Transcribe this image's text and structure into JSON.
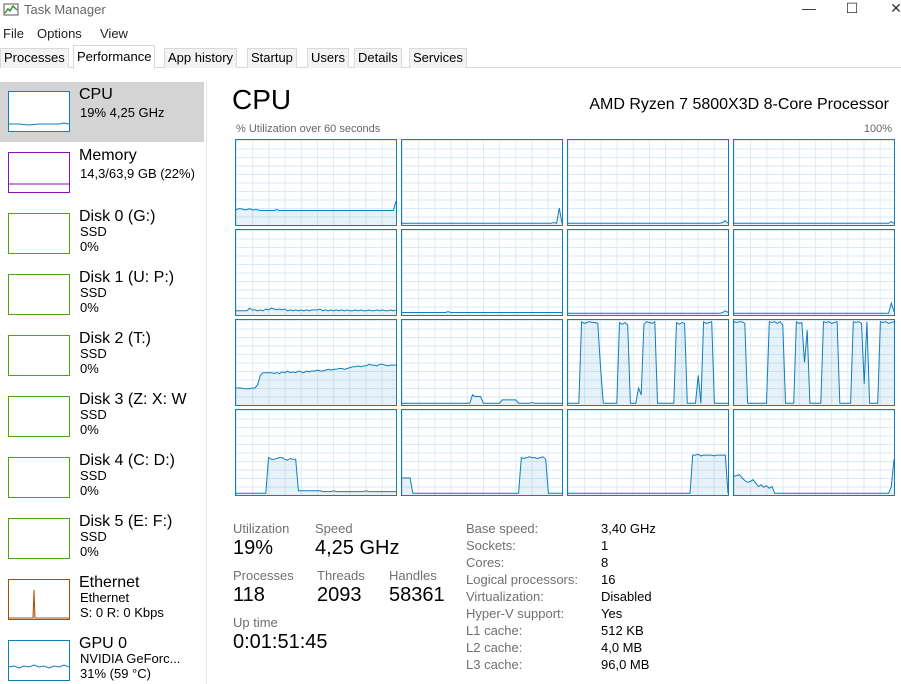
{
  "window": {
    "title": "Task Manager",
    "minimize": "—",
    "maximize": "☐",
    "close": "✕"
  },
  "menu": [
    "File",
    "Options",
    "View"
  ],
  "tabs": [
    "Processes",
    "Performance",
    "App history",
    "Startup",
    "Users",
    "Details",
    "Services"
  ],
  "active_tab": "Performance",
  "sidebar": [
    {
      "name": "CPU",
      "sub1": "19% 4,25 GHz",
      "sub2": "",
      "color": "#117dbb"
    },
    {
      "name": "Memory",
      "sub1": "14,3/63,9 GB (22%)",
      "sub2": "",
      "color": "#8b12ae"
    },
    {
      "name": "Disk 0 (G:)",
      "sub1": "SSD",
      "sub2": "0%",
      "color": "#4da60c"
    },
    {
      "name": "Disk 1 (U: P:)",
      "sub1": "SSD",
      "sub2": "0%",
      "color": "#4da60c"
    },
    {
      "name": "Disk 2 (T:)",
      "sub1": "SSD",
      "sub2": "0%",
      "color": "#4da60c"
    },
    {
      "name": "Disk 3 (Z: X: W",
      "sub1": "SSD",
      "sub2": "0%",
      "color": "#4da60c"
    },
    {
      "name": "Disk 4 (C: D:)",
      "sub1": "SSD",
      "sub2": "0%",
      "color": "#4da60c"
    },
    {
      "name": "Disk 5 (E: F:)",
      "sub1": "SSD",
      "sub2": "0%",
      "color": "#4da60c"
    },
    {
      "name": "Ethernet",
      "sub1": "Ethernet",
      "sub2": "S: 0 R: 0 Kbps",
      "color": "#a74f01"
    },
    {
      "name": "GPU 0",
      "sub1": "NVIDIA GeForc...",
      "sub2": "31% (59 °C)",
      "color": "#117dbb"
    }
  ],
  "main": {
    "title": "CPU",
    "model": "AMD Ryzen 7 5800X3D 8-Core Processor",
    "graph_label": "% Utilization over 60 seconds",
    "graph_max": "100%",
    "line_color": "#117dbb",
    "stats": {
      "utilization_label": "Utilization",
      "utilization": "19%",
      "speed_label": "Speed",
      "speed": "4,25 GHz",
      "processes_label": "Processes",
      "processes": "118",
      "threads_label": "Threads",
      "threads": "2093",
      "handles_label": "Handles",
      "handles": "58361",
      "uptime_label": "Up time",
      "uptime": "0:01:51:45"
    },
    "info": [
      {
        "label": "Base speed:",
        "value": "3,40 GHz"
      },
      {
        "label": "Sockets:",
        "value": "1"
      },
      {
        "label": "Cores:",
        "value": "8"
      },
      {
        "label": "Logical processors:",
        "value": "16"
      },
      {
        "label": "Virtualization:",
        "value": "Disabled"
      },
      {
        "label": "Hyper-V support:",
        "value": "Yes"
      },
      {
        "label": "L1 cache:",
        "value": "512 KB"
      },
      {
        "label": "L2 cache:",
        "value": "4,0 MB"
      },
      {
        "label": "L3 cache:",
        "value": "96,0 MB"
      }
    ]
  },
  "cores": [
    [
      18,
      19,
      19,
      18,
      18,
      19,
      18,
      18,
      18,
      17,
      17,
      17,
      17,
      17,
      17,
      18,
      17,
      17,
      17,
      17,
      17,
      17,
      17,
      17,
      17,
      17,
      17,
      17,
      17,
      17,
      17,
      17,
      17,
      17,
      17,
      17,
      17,
      17,
      17,
      17,
      17,
      17,
      17,
      17,
      17,
      17,
      17,
      17,
      17,
      17,
      17,
      17,
      17,
      17,
      17,
      17,
      17,
      17,
      17,
      28
    ],
    [
      2,
      2,
      2,
      2,
      2,
      2,
      2,
      2,
      2,
      2,
      2,
      2,
      2,
      2,
      2,
      2,
      2,
      2,
      2,
      2,
      2,
      2,
      2,
      2,
      2,
      2,
      2,
      2,
      2,
      2,
      2,
      2,
      2,
      2,
      2,
      2,
      2,
      2,
      2,
      2,
      2,
      2,
      2,
      2,
      2,
      2,
      2,
      2,
      2,
      2,
      2,
      2,
      2,
      2,
      2,
      2,
      3,
      2,
      20,
      2
    ],
    [
      2,
      2,
      2,
      2,
      2,
      2,
      2,
      2,
      2,
      2,
      2,
      2,
      2,
      2,
      2,
      2,
      2,
      2,
      2,
      2,
      2,
      2,
      2,
      2,
      2,
      2,
      2,
      2,
      2,
      2,
      2,
      2,
      2,
      2,
      2,
      2,
      2,
      2,
      2,
      2,
      2,
      2,
      2,
      2,
      2,
      2,
      2,
      2,
      2,
      2,
      2,
      2,
      2,
      2,
      2,
      2,
      2,
      3,
      5,
      2
    ],
    [
      2,
      2,
      2,
      2,
      2,
      2,
      2,
      2,
      2,
      2,
      2,
      2,
      2,
      2,
      2,
      2,
      2,
      2,
      2,
      2,
      2,
      2,
      2,
      2,
      2,
      2,
      2,
      2,
      2,
      2,
      2,
      2,
      2,
      2,
      2,
      2,
      2,
      2,
      2,
      2,
      2,
      2,
      2,
      2,
      2,
      2,
      2,
      2,
      2,
      2,
      2,
      2,
      2,
      2,
      2,
      2,
      2,
      2,
      4,
      2
    ],
    [
      5,
      5,
      5,
      5,
      5,
      8,
      6,
      6,
      5,
      6,
      5,
      7,
      6,
      8,
      7,
      6,
      7,
      6,
      7,
      5,
      6,
      5,
      6,
      5,
      6,
      5,
      6,
      5,
      6,
      6,
      6,
      7,
      5,
      6,
      5,
      6,
      5,
      6,
      5,
      6,
      5,
      6,
      5,
      5,
      6,
      5,
      6,
      5,
      5,
      6,
      5,
      5,
      6,
      5,
      6,
      5,
      5,
      6,
      5,
      6
    ],
    [
      3,
      3,
      3,
      3,
      3,
      3,
      3,
      3,
      3,
      3,
      3,
      3,
      3,
      3,
      3,
      3,
      3,
      4,
      3,
      3,
      3,
      3,
      3,
      3,
      3,
      3,
      3,
      3,
      3,
      3,
      3,
      3,
      3,
      3,
      3,
      3,
      3,
      3,
      3,
      3,
      3,
      3,
      3,
      3,
      3,
      3,
      3,
      3,
      3,
      3,
      3,
      3,
      3,
      3,
      3,
      3,
      3,
      3,
      3,
      3
    ],
    [
      2,
      2,
      2,
      2,
      2,
      2,
      2,
      2,
      2,
      2,
      2,
      2,
      2,
      2,
      2,
      2,
      2,
      2,
      2,
      2,
      2,
      2,
      2,
      2,
      2,
      2,
      2,
      2,
      2,
      2,
      2,
      2,
      2,
      2,
      2,
      2,
      2,
      2,
      2,
      2,
      2,
      2,
      2,
      2,
      2,
      2,
      2,
      2,
      2,
      2,
      2,
      2,
      2,
      2,
      2,
      2,
      2,
      3,
      5,
      3
    ],
    [
      2,
      2,
      2,
      2,
      2,
      2,
      2,
      2,
      2,
      2,
      2,
      2,
      2,
      2,
      2,
      2,
      2,
      2,
      2,
      2,
      2,
      2,
      2,
      2,
      2,
      2,
      2,
      2,
      2,
      2,
      2,
      2,
      2,
      2,
      2,
      2,
      2,
      2,
      2,
      2,
      2,
      2,
      2,
      2,
      2,
      2,
      2,
      2,
      2,
      2,
      2,
      2,
      2,
      2,
      2,
      2,
      2,
      2,
      14,
      4
    ],
    [
      20,
      20,
      20,
      19,
      19,
      19,
      20,
      20,
      24,
      35,
      38,
      38,
      38,
      38,
      37,
      38,
      37,
      39,
      38,
      40,
      38,
      39,
      38,
      40,
      39,
      38,
      40,
      39,
      40,
      40,
      41,
      40,
      40,
      41,
      42,
      41,
      42,
      42,
      43,
      43,
      42,
      43,
      44,
      45,
      45,
      46,
      45,
      46,
      46,
      48,
      47,
      47,
      46,
      48,
      48,
      47,
      46,
      47,
      47,
      47
    ],
    [
      2,
      2,
      2,
      2,
      2,
      2,
      2,
      2,
      2,
      2,
      2,
      2,
      2,
      2,
      2,
      2,
      2,
      2,
      2,
      2,
      2,
      2,
      2,
      2,
      2,
      2,
      12,
      10,
      10,
      10,
      2,
      2,
      2,
      2,
      2,
      2,
      2,
      6,
      6,
      6,
      6,
      6,
      6,
      2,
      2,
      2,
      2,
      2,
      3,
      2,
      2,
      2,
      2,
      2,
      2,
      2,
      2,
      2,
      2,
      2
    ],
    [
      2,
      2,
      2,
      2,
      2,
      98,
      96,
      97,
      98,
      97,
      97,
      96,
      45,
      2,
      2,
      2,
      2,
      2,
      2,
      97,
      95,
      97,
      94,
      2,
      2,
      2,
      20,
      12,
      95,
      98,
      97,
      96,
      98,
      2,
      2,
      2,
      2,
      2,
      2,
      2,
      97,
      95,
      97,
      96,
      2,
      2,
      2,
      2,
      35,
      2,
      98,
      96,
      97,
      98,
      2,
      2,
      2,
      2,
      2,
      2
    ],
    [
      98,
      97,
      98,
      98,
      96,
      2,
      2,
      2,
      2,
      2,
      2,
      2,
      2,
      98,
      97,
      98,
      96,
      98,
      94,
      2,
      2,
      2,
      2,
      98,
      96,
      97,
      50,
      88,
      2,
      2,
      2,
      2,
      2,
      98,
      97,
      98,
      96,
      97,
      98,
      2,
      2,
      2,
      2,
      2,
      98,
      97,
      98,
      96,
      25,
      98,
      2,
      2,
      2,
      2,
      98,
      97,
      98,
      96,
      97,
      98
    ],
    [
      2,
      2,
      2,
      2,
      2,
      2,
      2,
      2,
      2,
      2,
      2,
      2,
      44,
      42,
      42,
      43,
      44,
      44,
      42,
      41,
      43,
      42,
      42,
      5,
      5,
      5,
      5,
      5,
      5,
      5,
      5,
      5,
      4,
      4,
      4,
      4,
      5,
      4,
      4,
      4,
      4,
      4,
      4,
      4,
      4,
      4,
      4,
      4,
      5,
      4,
      4,
      4,
      4,
      4,
      4,
      4,
      4,
      4,
      4,
      4
    ],
    [
      20,
      20,
      20,
      20,
      2,
      2,
      2,
      2,
      2,
      2,
      2,
      2,
      2,
      2,
      2,
      2,
      2,
      2,
      2,
      2,
      2,
      2,
      2,
      2,
      2,
      2,
      2,
      2,
      2,
      2,
      2,
      2,
      2,
      2,
      2,
      2,
      2,
      2,
      2,
      2,
      2,
      2,
      2,
      2,
      44,
      43,
      44,
      45,
      44,
      44,
      43,
      44,
      45,
      42,
      2,
      2,
      2,
      2,
      2,
      2
    ],
    [
      2,
      2,
      2,
      2,
      2,
      2,
      2,
      2,
      2,
      2,
      2,
      2,
      2,
      2,
      2,
      2,
      2,
      2,
      2,
      2,
      2,
      2,
      2,
      2,
      2,
      2,
      2,
      2,
      2,
      2,
      2,
      2,
      2,
      2,
      2,
      2,
      2,
      2,
      2,
      2,
      2,
      2,
      2,
      2,
      2,
      2,
      47,
      47,
      48,
      46,
      47,
      47,
      47,
      47,
      46,
      47,
      47,
      47,
      47,
      2
    ],
    [
      22,
      23,
      24,
      20,
      17,
      15,
      16,
      18,
      14,
      10,
      12,
      9,
      11,
      8,
      10,
      2,
      2,
      2,
      2,
      2,
      2,
      2,
      2,
      2,
      2,
      2,
      2,
      2,
      2,
      2,
      2,
      2,
      2,
      2,
      2,
      2,
      2,
      2,
      2,
      2,
      2,
      2,
      2,
      2,
      2,
      2,
      2,
      2,
      2,
      2,
      2,
      2,
      2,
      2,
      2,
      2,
      2,
      2,
      10,
      42
    ]
  ]
}
